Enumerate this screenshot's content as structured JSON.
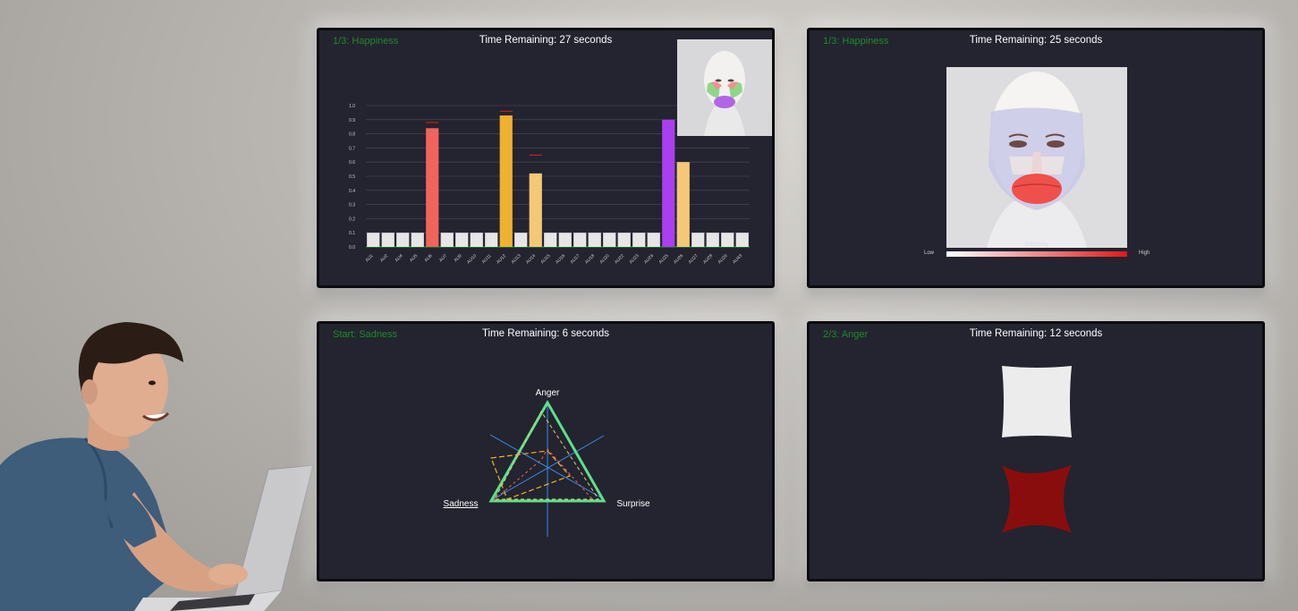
{
  "panels": {
    "p1": {
      "status": "1/3: Happiness",
      "timer": "Time Remaining: 27 seconds"
    },
    "p2": {
      "status": "1/3: Happiness",
      "timer": "Time Remaining: 25 seconds"
    },
    "p3": {
      "status": "Start: Sadness",
      "timer": "Time Remaining: 6 seconds"
    },
    "p4": {
      "status": "2/3: Anger",
      "timer": "Time Remaining: 12 seconds"
    }
  },
  "colors": {
    "status_green": "#1f8a2a",
    "panel_bg": "#23242f",
    "bar_default": "#e6e6e6",
    "bar_red": "#f0645c",
    "bar_orange": "#f0b030",
    "bar_light_orange": "#f5c878",
    "bar_purple": "#a93ff0",
    "radar_green": "#5ee08a",
    "radar_blue": "#3a8ee6",
    "shape_red": "#8a0d0d"
  },
  "chart_data": {
    "type": "bar",
    "categories": [
      "AU1",
      "AU2",
      "AU4",
      "AU5",
      "AU6",
      "AU7",
      "AU9",
      "AU10",
      "AU11",
      "AU12",
      "AU13",
      "AU14",
      "AU15",
      "AU16",
      "AU17",
      "AU18",
      "AU20",
      "AU22",
      "AU23",
      "AU24",
      "AU25",
      "AU26",
      "AU27",
      "AU28",
      "AU29",
      "AU43"
    ],
    "values": [
      0.1,
      0.1,
      0.1,
      0.1,
      0.84,
      0.1,
      0.1,
      0.1,
      0.1,
      0.93,
      0.1,
      0.52,
      0.1,
      0.1,
      0.1,
      0.1,
      0.1,
      0.1,
      0.1,
      0.1,
      0.9,
      0.6,
      0.1,
      0.1,
      0.1,
      0.1
    ],
    "bar_colors": [
      "default",
      "default",
      "default",
      "default",
      "red",
      "default",
      "default",
      "default",
      "default",
      "orange",
      "default",
      "light_orange",
      "default",
      "default",
      "default",
      "default",
      "default",
      "default",
      "default",
      "default",
      "purple",
      "light_orange",
      "default",
      "default",
      "default",
      "default"
    ],
    "markers": [
      {
        "index": 4,
        "value": 0.88
      },
      {
        "index": 9,
        "value": 0.96
      },
      {
        "index": 11,
        "value": 0.65
      }
    ],
    "yticks": [
      "0.0",
      "0.1",
      "0.2",
      "0.3",
      "0.4",
      "0.5",
      "0.6",
      "0.7",
      "0.8",
      "0.9",
      "1.0"
    ],
    "ylim": [
      0,
      1.0
    ],
    "grid": true
  },
  "intensity": {
    "title": "Intensity",
    "low": "Low",
    "high": "High"
  },
  "radar": {
    "axes": [
      "Anger",
      "Sadness",
      "Surprise"
    ]
  }
}
